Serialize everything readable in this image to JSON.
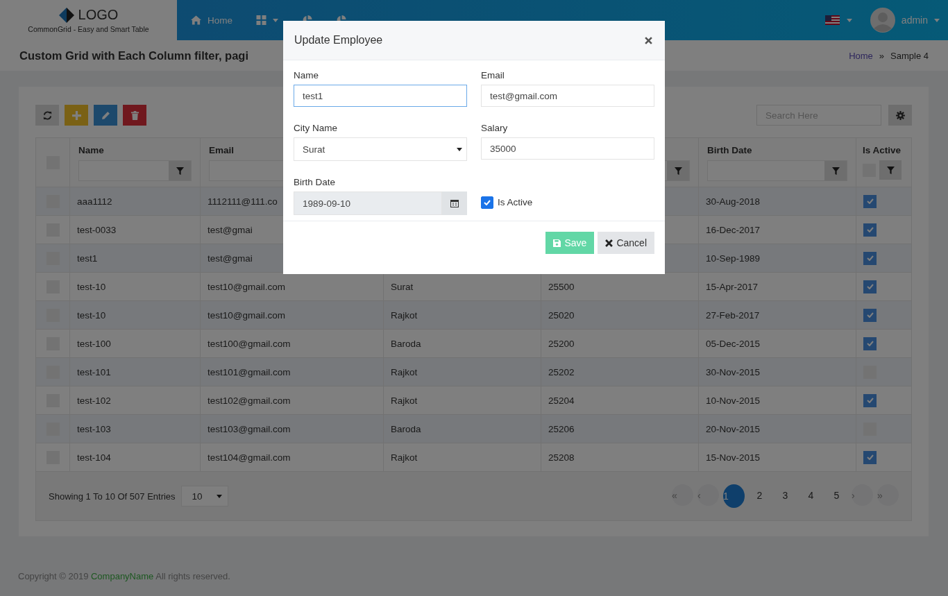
{
  "header": {
    "logo": "LOGO",
    "tagline": "CommonGrid - Easy and Smart Table",
    "nav": [
      {
        "label": "Home",
        "kind": "home",
        "dropdown": false
      },
      {
        "kind": "grid",
        "dropdown": true
      },
      {
        "kind": "chart",
        "dropdown": false
      },
      {
        "kind": "chart",
        "dropdown": false
      }
    ],
    "user": "admin"
  },
  "page_title": "Custom Grid with Each Column filter, pagi",
  "breadcrumb": [
    {
      "label": "Home",
      "link": true
    },
    {
      "label": "»",
      "link": false
    },
    {
      "label": "Sample 4",
      "link": false
    }
  ],
  "toolbar": {
    "search": {
      "placeholder": "Search Here"
    }
  },
  "table": {
    "select_all": {
      "checked": false
    },
    "columns": {
      "name": "Name",
      "email": "Email",
      "birth_date": "Birth Date",
      "is_active": "Is Active"
    },
    "is_active_filter": {
      "checked": false
    },
    "rows": [
      {
        "selected": false,
        "name": "aaa1112",
        "email": "1112111@111.co",
        "birth_date": "30-Aug-2018",
        "is_active": true
      },
      {
        "selected": false,
        "name": "test-0033",
        "email": "test@gmai",
        "birth_date": "16-Dec-2017",
        "is_active": true
      },
      {
        "selected": false,
        "name": "test1",
        "email": "test@gmai",
        "birth_date": "10-Sep-1989",
        "is_active": true
      },
      {
        "selected": false,
        "name": "test-10",
        "email": "test10@gmail.com",
        "column_3": "Surat",
        "column_4": "25500",
        "birth_date": "15-Apr-2017",
        "is_active": true
      },
      {
        "selected": false,
        "name": "test-10",
        "email": "test10@gmail.com",
        "column_3": "Rajkot",
        "column_4": "25020",
        "birth_date": "27-Feb-2017",
        "is_active": true
      },
      {
        "selected": false,
        "name": "test-100",
        "email": "test100@gmail.com",
        "column_3": "Baroda",
        "column_4": "25200",
        "birth_date": "05-Dec-2015",
        "is_active": true
      },
      {
        "selected": false,
        "name": "test-101",
        "email": "test101@gmail.com",
        "column_3": "Rajkot",
        "column_4": "25202",
        "birth_date": "30-Nov-2015",
        "is_active": false
      },
      {
        "selected": false,
        "name": "test-102",
        "email": "test102@gmail.com",
        "column_3": "Rajkot",
        "column_4": "25204",
        "birth_date": "10-Nov-2015",
        "is_active": true
      },
      {
        "selected": false,
        "name": "test-103",
        "email": "test103@gmail.com",
        "column_3": "Baroda",
        "column_4": "25206",
        "birth_date": "20-Nov-2015",
        "is_active": false
      },
      {
        "selected": false,
        "name": "test-104",
        "email": "test104@gmail.com",
        "column_3": "Rajkot",
        "column_4": "25208",
        "birth_date": "15-Nov-2015",
        "is_active": true
      }
    ],
    "footer": {
      "summary": "Showing 1 To 10 Of 507 Entries",
      "page_size": "10",
      "pagination": {
        "first": "«",
        "prev": "‹",
        "pages": [
          {
            "label": "1",
            "selected": true
          },
          {
            "label": "2",
            "selected": false
          },
          {
            "label": "3",
            "selected": false
          },
          {
            "label": "4",
            "selected": false
          },
          {
            "label": "5",
            "selected": false
          }
        ],
        "next": "›",
        "last": "»"
      }
    }
  },
  "copyright": {
    "before": "Copyright © 2019",
    "company": "CompanyName",
    "after": "All rights reserved."
  },
  "modal": {
    "title": "Update Employee",
    "fields": [
      {
        "kind": "text",
        "label": "Name",
        "value": "test1",
        "focused": true
      },
      {
        "kind": "text",
        "label": "Email",
        "value": "test@gmail.com",
        "focused": false
      },
      {
        "kind": "select",
        "label": "City Name",
        "value": "Surat"
      },
      {
        "kind": "text",
        "label": "Salary",
        "value": "35000",
        "focused": false
      },
      {
        "kind": "date",
        "label": "Birth Date",
        "value": "1989-09-10"
      },
      {
        "kind": "checkbox",
        "label": "Is Active",
        "checked": true
      }
    ],
    "buttons": [
      {
        "kind": "save",
        "label": "Save"
      },
      {
        "kind": "cancel",
        "label": "Cancel"
      }
    ]
  }
}
